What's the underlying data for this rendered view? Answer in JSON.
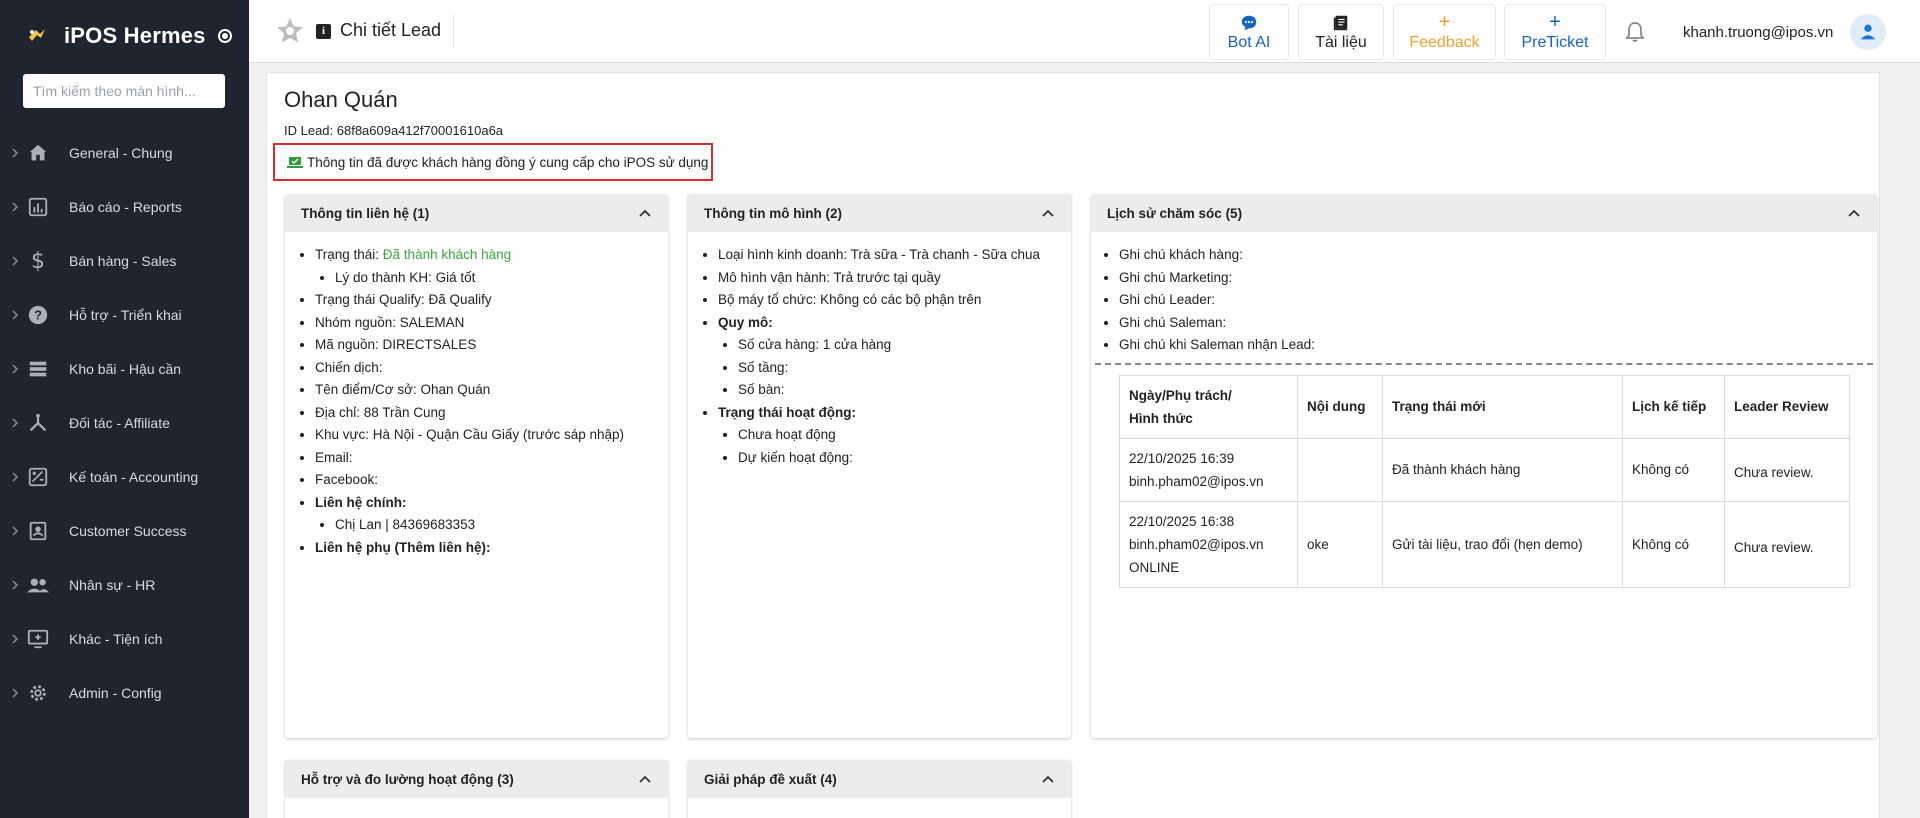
{
  "app": {
    "title": "iPOS Hermes"
  },
  "sidebar": {
    "search_placeholder": "Tìm kiếm theo màn hình...",
    "items": [
      {
        "label": "General - Chung",
        "icon": "home-icon"
      },
      {
        "label": "Báo cáo - Reports",
        "icon": "bar-chart-icon"
      },
      {
        "label": "Bán hàng - Sales",
        "icon": "dollar-icon"
      },
      {
        "label": "Hỗ trợ - Triển khai",
        "icon": "help-icon"
      },
      {
        "label": "Kho bãi - Hậu cần",
        "icon": "storage-icon"
      },
      {
        "label": "Đối tác - Affiliate",
        "icon": "merge-icon"
      },
      {
        "label": "Kế toán - Accounting",
        "icon": "accounting-icon"
      },
      {
        "label": "Customer Success",
        "icon": "contact-card-icon"
      },
      {
        "label": "Nhân sự - HR",
        "icon": "people-icon"
      },
      {
        "label": "Khác - Tiện ích",
        "icon": "monitor-add-icon"
      },
      {
        "label": "Admin - Config",
        "icon": "gear-icon"
      }
    ]
  },
  "topbar": {
    "page_title": "Chi tiết Lead",
    "buttons": {
      "bot_ai": "Bot AI",
      "docs": "Tài liệu",
      "feedback": "Feedback",
      "preticket": "PreTicket"
    },
    "user_email": "khanh.truong@ipos.vn"
  },
  "colors": {
    "accent_blue": "#1565c0",
    "feedback_orange": "#f0a030",
    "status_green": "#3aa83a",
    "sidebar_bg": "#1e2530"
  },
  "lead": {
    "name": "Ohan Quán",
    "id_text": "ID Lead: 68f8a609a412f70001610a6a",
    "consent_text": "Thông tin đã được khách hàng đồng ý cung cấp cho iPOS sử dụng"
  },
  "card1": {
    "title": "Thông tin liên hệ (1)",
    "status_label": "Trạng thái: ",
    "status_value": "Đã thành khách hàng",
    "reason": "Lý do thành KH: Giá tốt",
    "qualify": "Trạng thái Qualify: Đã Qualify",
    "source_group": "Nhóm nguồn: SALEMAN",
    "source_code": "Mã nguồn: DIRECTSALES",
    "campaign": "Chiến dịch:",
    "store_name": "Tên điểm/Cơ sở: Ohan Quán",
    "address": "Địa chỉ: 88 Trần Cung",
    "area": "Khu vực: Hà Nội - Quận Cầu Giấy (trước sáp nhập)",
    "email": "Email:",
    "facebook": "Facebook:",
    "main_contact_label": "Liên hệ chính:",
    "main_contact": "Chị Lan | 84369683353",
    "sub_contact_label": "Liên hệ phụ (Thêm liên hệ):"
  },
  "card2": {
    "title": "Thông tin mô hình (2)",
    "business_type": "Loại hình kinh doanh: Trà sữa - Trà chanh - Sữa chua",
    "operation_model": "Mô hình vận hành: Trả trước tại quầy",
    "org": "Bộ máy tổ chức: Không có các bộ phận trên",
    "scale_label": "Quy mô:",
    "stores": "Số cửa hàng: 1 cửa hàng",
    "floors": "Số tầng:",
    "tables": "Số bàn:",
    "op_status_label": "Trạng thái hoạt động:",
    "op_status": "Chưa hoạt động",
    "op_expected": "Dự kiến hoạt động:"
  },
  "card3": {
    "title": "Lịch sử chăm sóc (5)",
    "notes": [
      "Ghi chú khách hàng:",
      "Ghi chú Marketing:",
      "Ghi chú Leader:",
      "Ghi chú Saleman:",
      "Ghi chú khi Saleman nhận Lead:"
    ],
    "columns": {
      "c1a": "Ngày/Phụ trách/",
      "c1b": "Hình thức",
      "c2": "Nội dung",
      "c3": "Trạng thái mới",
      "c4": "Lịch kế tiếp",
      "c5": "Leader Review"
    },
    "rows": [
      {
        "date": "22/10/2025 16:39",
        "owner": "binh.pham02@ipos.vn",
        "method": "",
        "content": "",
        "status": "Đã thành khách hàng",
        "next": "Không có",
        "review": "Chưa review."
      },
      {
        "date": "22/10/2025 16:38",
        "owner": "binh.pham02@ipos.vn",
        "method": "ONLINE",
        "content": "oke",
        "status": "Gửi tài liệu, trao đổi (hẹn demo)",
        "next": "Không có",
        "review": "Chưa review."
      }
    ]
  },
  "card4": {
    "title": "Hỗ trợ và đo lường hoạt động (3)"
  },
  "card5": {
    "title": "Giải pháp đề xuất (4)"
  }
}
